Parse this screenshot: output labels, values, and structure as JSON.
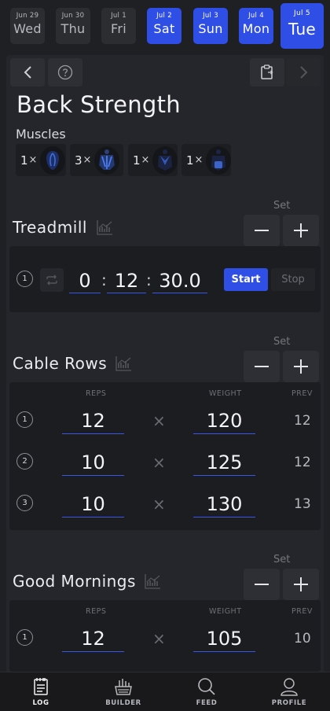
{
  "dates": [
    {
      "md": "Jun 29",
      "dow": "Wed",
      "selected": false
    },
    {
      "md": "Jun 30",
      "dow": "Thu",
      "selected": false
    },
    {
      "md": "Jul  1",
      "dow": "Fri",
      "selected": false
    },
    {
      "md": "Jul  2",
      "dow": "Sat",
      "selected": true
    },
    {
      "md": "Jul  3",
      "dow": "Sun",
      "selected": true
    },
    {
      "md": "Jul  4",
      "dow": "Mon",
      "selected": true
    },
    {
      "md": "Jul  5",
      "dow": "Tue",
      "selected": true
    }
  ],
  "workout": {
    "title": "Back Strength",
    "muscles_label": "Muscles",
    "muscles": [
      {
        "count": "1",
        "x": "×",
        "icon": "upper-back-muscle-icon"
      },
      {
        "count": "3",
        "x": "×",
        "icon": "lats-muscle-icon"
      },
      {
        "count": "1",
        "x": "×",
        "icon": "traps-muscle-icon"
      },
      {
        "count": "1",
        "x": "×",
        "icon": "lower-back-muscle-icon"
      }
    ]
  },
  "set_label": "Set",
  "columns": {
    "reps": "REPS",
    "weight": "WEIGHT",
    "prev": "PREV"
  },
  "times_symbol": "×",
  "exercises": [
    {
      "name": "Treadmill",
      "type": "timed",
      "set_number": "1",
      "hours": "0",
      "minutes": "12",
      "seconds": "30.0",
      "colon": ":",
      "start_label": "Start",
      "stop_label": "Stop"
    },
    {
      "name": "Cable Rows",
      "type": "sets",
      "sets": [
        {
          "num": "1",
          "reps": "12",
          "weight": "120",
          "prev": "12"
        },
        {
          "num": "2",
          "reps": "10",
          "weight": "125",
          "prev": "12"
        },
        {
          "num": "3",
          "reps": "10",
          "weight": "130",
          "prev": "13"
        }
      ]
    },
    {
      "name": "Good Mornings",
      "type": "sets",
      "sets": [
        {
          "num": "1",
          "reps": "12",
          "weight": "105",
          "prev": "10"
        }
      ]
    }
  ],
  "bottom_nav": [
    {
      "label": "LOG",
      "icon": "log-icon",
      "active": true
    },
    {
      "label": "BUILDER",
      "icon": "builder-icon",
      "active": false
    },
    {
      "label": "FEED",
      "icon": "search-icon",
      "active": false
    },
    {
      "label": "PROFILE",
      "icon": "profile-icon",
      "active": false
    }
  ],
  "colors": {
    "accent": "#2f4ee6",
    "background": "#1f2024",
    "panel": "#1c1d21"
  }
}
